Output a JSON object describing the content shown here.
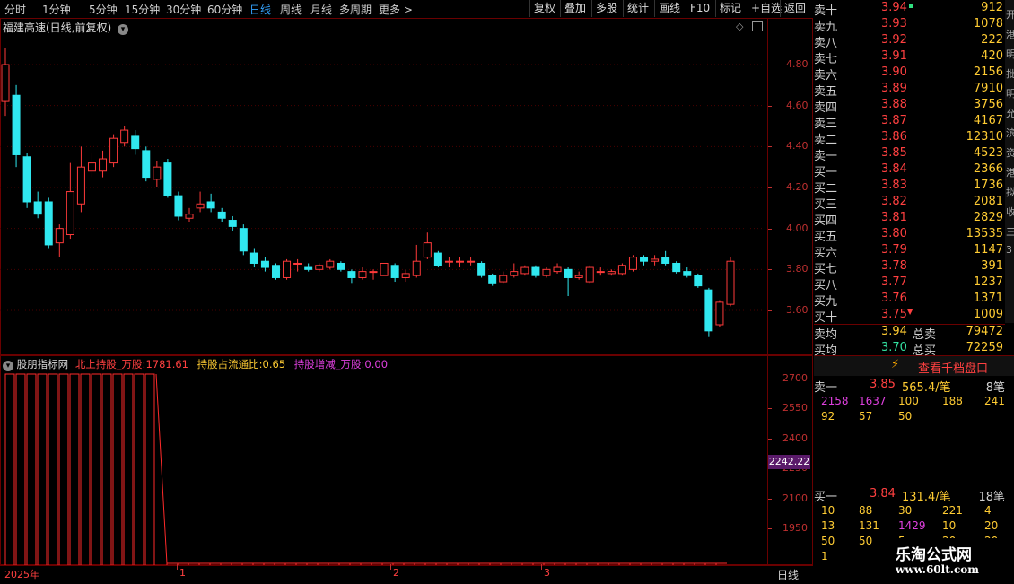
{
  "toolbar": {
    "periods": [
      "分时",
      "1分钟",
      "5分钟",
      "15分钟",
      "30分钟",
      "60分钟",
      "日线",
      "周线",
      "月线",
      "多周期",
      "更多 >"
    ],
    "active_period": "日线",
    "buttons": [
      "复权",
      "叠加",
      "多股",
      "统计",
      "画线",
      "F10",
      "标记",
      "+自选",
      "返回"
    ]
  },
  "price_chart": {
    "title": "福建高速(日线,前复权)",
    "y_ticks": [
      "4.80",
      "4.60",
      "4.40",
      "4.20",
      "4.00",
      "3.80",
      "3.60"
    ],
    "candles": [
      {
        "o": 4.62,
        "c": 4.8,
        "h": 4.88,
        "l": 4.55
      },
      {
        "o": 4.65,
        "c": 4.36,
        "h": 4.7,
        "l": 4.3
      },
      {
        "o": 4.35,
        "c": 4.13,
        "h": 4.37,
        "l": 4.1
      },
      {
        "o": 4.13,
        "c": 4.07,
        "h": 4.18,
        "l": 4.05
      },
      {
        "o": 4.13,
        "c": 3.92,
        "h": 4.15,
        "l": 3.9
      },
      {
        "o": 3.93,
        "c": 4.0,
        "h": 4.02,
        "l": 3.86
      },
      {
        "o": 3.97,
        "c": 4.18,
        "h": 4.32,
        "l": 3.95
      },
      {
        "o": 4.12,
        "c": 4.3,
        "h": 4.4,
        "l": 4.08
      },
      {
        "o": 4.28,
        "c": 4.32,
        "h": 4.37,
        "l": 4.25
      },
      {
        "o": 4.28,
        "c": 4.34,
        "h": 4.38,
        "l": 4.25
      },
      {
        "o": 4.32,
        "c": 4.44,
        "h": 4.46,
        "l": 4.3
      },
      {
        "o": 4.42,
        "c": 4.48,
        "h": 4.5,
        "l": 4.4
      },
      {
        "o": 4.45,
        "c": 4.39,
        "h": 4.48,
        "l": 4.36
      },
      {
        "o": 4.38,
        "c": 4.25,
        "h": 4.4,
        "l": 4.23
      },
      {
        "o": 4.24,
        "c": 4.3,
        "h": 4.33,
        "l": 4.2
      },
      {
        "o": 4.32,
        "c": 4.16,
        "h": 4.34,
        "l": 4.15
      },
      {
        "o": 4.16,
        "c": 4.06,
        "h": 4.18,
        "l": 4.04
      },
      {
        "o": 4.05,
        "c": 4.07,
        "h": 4.1,
        "l": 4.03
      },
      {
        "o": 4.1,
        "c": 4.12,
        "h": 4.18,
        "l": 4.08
      },
      {
        "o": 4.13,
        "c": 4.1,
        "h": 4.17,
        "l": 4.08
      },
      {
        "o": 4.08,
        "c": 4.05,
        "h": 4.1,
        "l": 4.03
      },
      {
        "o": 4.04,
        "c": 4.01,
        "h": 4.06,
        "l": 3.99
      },
      {
        "o": 4.0,
        "c": 3.89,
        "h": 4.02,
        "l": 3.87
      },
      {
        "o": 3.88,
        "c": 3.83,
        "h": 3.9,
        "l": 3.81
      },
      {
        "o": 3.84,
        "c": 3.81,
        "h": 3.86,
        "l": 3.79
      },
      {
        "o": 3.82,
        "c": 3.76,
        "h": 3.83,
        "l": 3.75
      },
      {
        "o": 3.76,
        "c": 3.84,
        "h": 3.85,
        "l": 3.75
      },
      {
        "o": 3.83,
        "c": 3.83,
        "h": 3.85,
        "l": 3.79
      },
      {
        "o": 3.81,
        "c": 3.8,
        "h": 3.83,
        "l": 3.79
      },
      {
        "o": 3.8,
        "c": 3.82,
        "h": 3.83,
        "l": 3.79
      },
      {
        "o": 3.81,
        "c": 3.84,
        "h": 3.85,
        "l": 3.8
      },
      {
        "o": 3.83,
        "c": 3.8,
        "h": 3.84,
        "l": 3.79
      },
      {
        "o": 3.79,
        "c": 3.76,
        "h": 3.8,
        "l": 3.73
      },
      {
        "o": 3.76,
        "c": 3.79,
        "h": 3.81,
        "l": 3.75
      },
      {
        "o": 3.79,
        "c": 3.79,
        "h": 3.8,
        "l": 3.75
      },
      {
        "o": 3.77,
        "c": 3.83,
        "h": 3.83,
        "l": 3.77
      },
      {
        "o": 3.82,
        "c": 3.76,
        "h": 3.83,
        "l": 3.74
      },
      {
        "o": 3.76,
        "c": 3.78,
        "h": 3.8,
        "l": 3.74
      },
      {
        "o": 3.77,
        "c": 3.84,
        "h": 3.92,
        "l": 3.76
      },
      {
        "o": 3.86,
        "c": 3.93,
        "h": 3.98,
        "l": 3.85
      },
      {
        "o": 3.88,
        "c": 3.82,
        "h": 3.89,
        "l": 3.81
      },
      {
        "o": 3.84,
        "c": 3.84,
        "h": 3.86,
        "l": 3.81
      },
      {
        "o": 3.84,
        "c": 3.84,
        "h": 3.86,
        "l": 3.81
      },
      {
        "o": 3.84,
        "c": 3.84,
        "h": 3.86,
        "l": 3.82
      },
      {
        "o": 3.83,
        "c": 3.77,
        "h": 3.84,
        "l": 3.76
      },
      {
        "o": 3.77,
        "c": 3.73,
        "h": 3.78,
        "l": 3.72
      },
      {
        "o": 3.74,
        "c": 3.77,
        "h": 3.79,
        "l": 3.73
      },
      {
        "o": 3.77,
        "c": 3.79,
        "h": 3.83,
        "l": 3.76
      },
      {
        "o": 3.78,
        "c": 3.81,
        "h": 3.82,
        "l": 3.77
      },
      {
        "o": 3.81,
        "c": 3.77,
        "h": 3.82,
        "l": 3.76
      },
      {
        "o": 3.77,
        "c": 3.8,
        "h": 3.81,
        "l": 3.76
      },
      {
        "o": 3.79,
        "c": 3.81,
        "h": 3.83,
        "l": 3.78
      },
      {
        "o": 3.8,
        "c": 3.76,
        "h": 3.81,
        "l": 3.67
      },
      {
        "o": 3.76,
        "c": 3.77,
        "h": 3.79,
        "l": 3.75
      },
      {
        "o": 3.74,
        "c": 3.81,
        "h": 3.82,
        "l": 3.73
      },
      {
        "o": 3.79,
        "c": 3.79,
        "h": 3.81,
        "l": 3.77
      },
      {
        "o": 3.78,
        "c": 3.79,
        "h": 3.8,
        "l": 3.77
      },
      {
        "o": 3.78,
        "c": 3.82,
        "h": 3.83,
        "l": 3.77
      },
      {
        "o": 3.8,
        "c": 3.86,
        "h": 3.87,
        "l": 3.79
      },
      {
        "o": 3.86,
        "c": 3.84,
        "h": 3.87,
        "l": 3.82
      },
      {
        "o": 3.84,
        "c": 3.85,
        "h": 3.87,
        "l": 3.82
      },
      {
        "o": 3.86,
        "c": 3.83,
        "h": 3.89,
        "l": 3.82
      },
      {
        "o": 3.83,
        "c": 3.79,
        "h": 3.84,
        "l": 3.78
      },
      {
        "o": 3.79,
        "c": 3.77,
        "h": 3.81,
        "l": 3.76
      },
      {
        "o": 3.77,
        "c": 3.72,
        "h": 3.78,
        "l": 3.71
      },
      {
        "o": 3.7,
        "c": 3.5,
        "h": 3.71,
        "l": 3.47
      },
      {
        "o": 3.53,
        "c": 3.64,
        "h": 3.65,
        "l": 3.52
      },
      {
        "o": 3.63,
        "c": 3.84,
        "h": 3.86,
        "l": 3.62
      }
    ]
  },
  "indicator": {
    "name": "股朋指标网",
    "lines": [
      {
        "label": "北上持股_万股:",
        "value": "1781.61"
      },
      {
        "label": "持股占流通比:",
        "value": "0.65"
      },
      {
        "label": "持股增减_万股:",
        "value": "0.00"
      }
    ],
    "y_ticks": [
      "2700",
      "2550",
      "2400",
      "2250",
      "2100",
      "1950"
    ],
    "current_value_tag": "2242.22",
    "x_labels": [
      "2025年",
      "1",
      "2",
      "3"
    ],
    "period_label": "日线",
    "bars_high": 2700,
    "bars_low": 1781.61
  },
  "order_book": {
    "asks": [
      {
        "label": "卖十",
        "price": "3.94",
        "vol": "912",
        "color": "red"
      },
      {
        "label": "卖九",
        "price": "3.93",
        "vol": "1078",
        "color": "red"
      },
      {
        "label": "卖八",
        "price": "3.92",
        "vol": "222",
        "color": "red"
      },
      {
        "label": "卖七",
        "price": "3.91",
        "vol": "420",
        "color": "red"
      },
      {
        "label": "卖六",
        "price": "3.90",
        "vol": "2156",
        "color": "red"
      },
      {
        "label": "卖五",
        "price": "3.89",
        "vol": "7910",
        "color": "red"
      },
      {
        "label": "卖四",
        "price": "3.88",
        "vol": "3756",
        "color": "red"
      },
      {
        "label": "卖三",
        "price": "3.87",
        "vol": "4167",
        "color": "red"
      },
      {
        "label": "卖二",
        "price": "3.86",
        "vol": "12310",
        "color": "red"
      },
      {
        "label": "卖一",
        "price": "3.85",
        "vol": "4523",
        "color": "red"
      }
    ],
    "bids": [
      {
        "label": "买一",
        "price": "3.84",
        "vol": "2366",
        "color": "red"
      },
      {
        "label": "买二",
        "price": "3.83",
        "vol": "1736",
        "color": "red"
      },
      {
        "label": "买三",
        "price": "3.82",
        "vol": "2081",
        "color": "red"
      },
      {
        "label": "买四",
        "price": "3.81",
        "vol": "2829",
        "color": "red"
      },
      {
        "label": "买五",
        "price": "3.80",
        "vol": "13535",
        "color": "red"
      },
      {
        "label": "买六",
        "price": "3.79",
        "vol": "1147",
        "color": "red"
      },
      {
        "label": "买七",
        "price": "3.78",
        "vol": "391",
        "color": "red"
      },
      {
        "label": "买八",
        "price": "3.77",
        "vol": "1237",
        "color": "red"
      },
      {
        "label": "买九",
        "price": "3.76",
        "vol": "1371",
        "color": "red"
      },
      {
        "label": "买十",
        "price": "3.75",
        "vol": "1009",
        "color": "red"
      }
    ],
    "summary": [
      {
        "label": "卖均",
        "price": "3.94",
        "label2": "总卖",
        "vol": "79472"
      },
      {
        "label": "买均",
        "price": "3.70",
        "label2": "总买",
        "vol": "72259"
      }
    ],
    "qiandang_button": "查看千档盘口",
    "sell1_queue": {
      "label": "卖一",
      "price": "3.85",
      "avg": "565.4/笔",
      "count": "8笔",
      "rows": [
        [
          "2158",
          "1637",
          "100",
          "188",
          "241"
        ],
        [
          "92",
          "57",
          "50",
          "",
          ""
        ]
      ]
    },
    "buy1_queue": {
      "label": "买一",
      "price": "3.84",
      "avg": "131.4/笔",
      "count": "18笔",
      "rows": [
        [
          "10",
          "88",
          "30",
          "221",
          "4"
        ],
        [
          "13",
          "131",
          "1429",
          "10",
          "20"
        ],
        [
          "50",
          "50",
          "5",
          "20",
          "20"
        ],
        [
          "1",
          "",
          "",
          "",
          ""
        ]
      ]
    }
  },
  "side_strip": [
    "开",
    "港",
    "明",
    "批",
    "明",
    "允",
    "滨",
    "资",
    "港",
    "拟",
    "收",
    "三",
    "3"
  ],
  "watermark": {
    "line1": "乐淘公式网",
    "line2": "www.60lt.com"
  }
}
